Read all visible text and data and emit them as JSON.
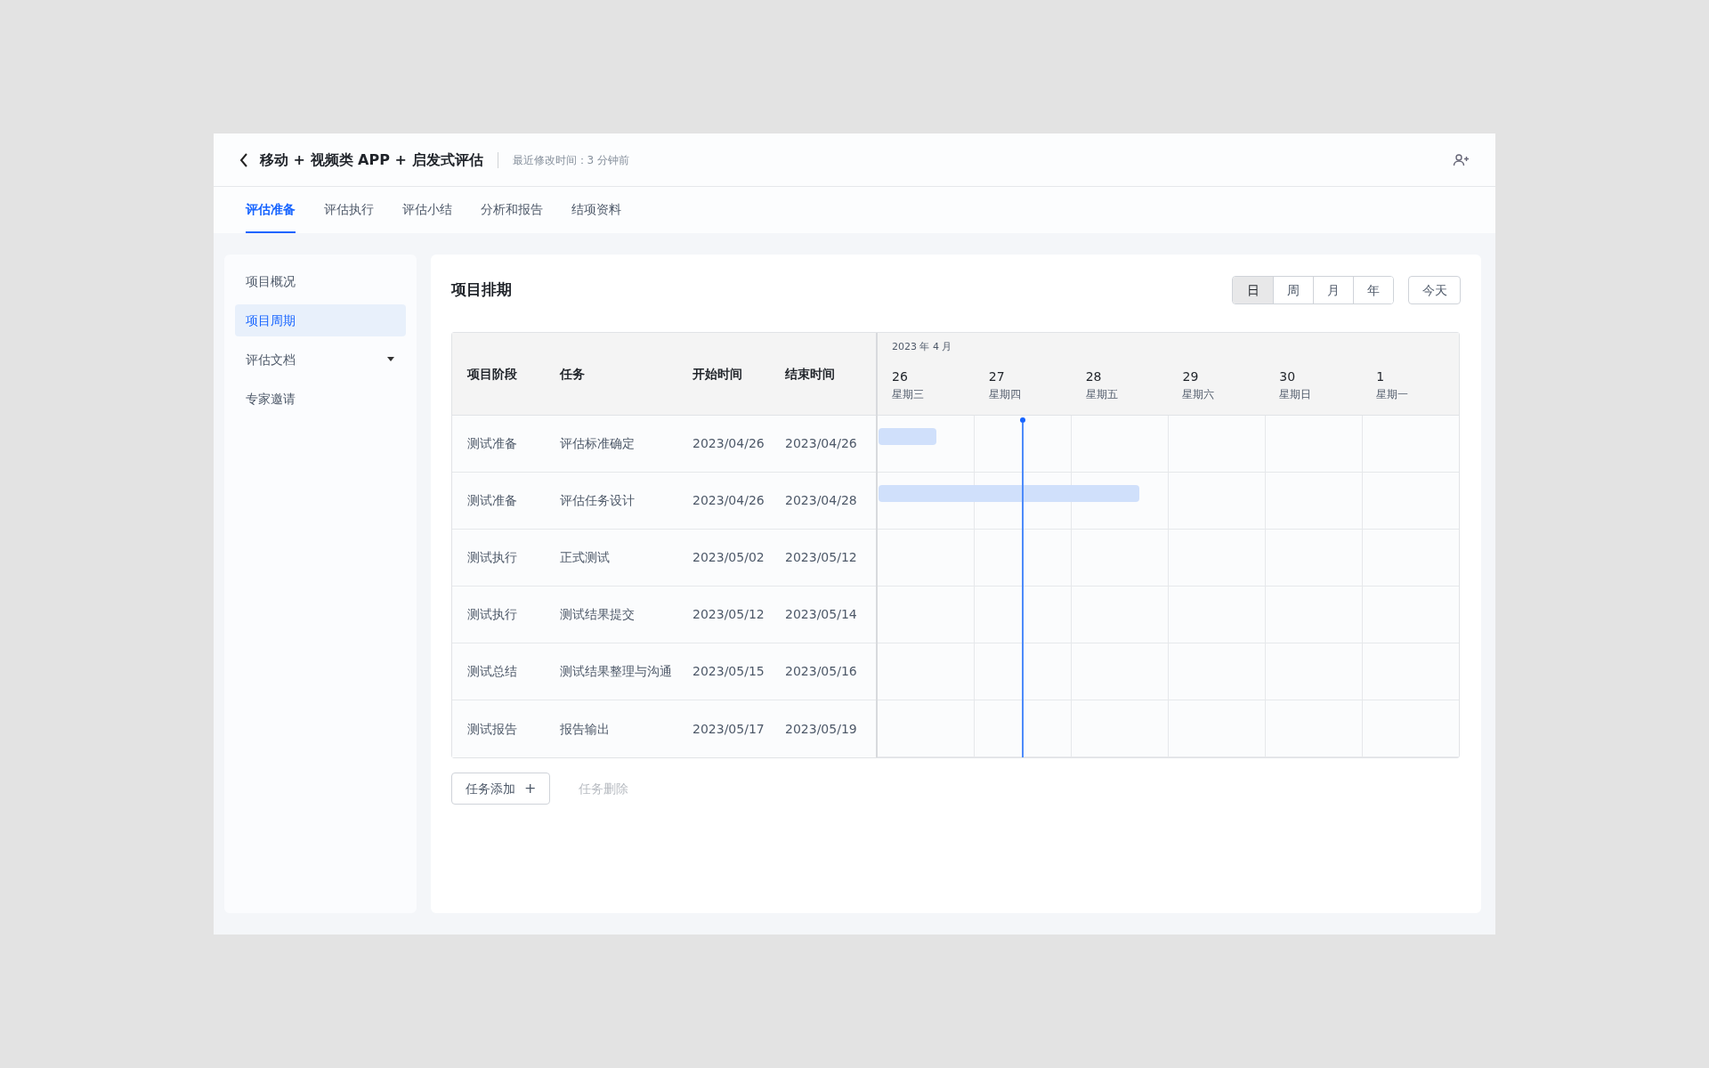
{
  "header": {
    "title": "移动 + 视频类 APP + 启发式评估",
    "subtitle": "最近修改时间：3 分钟前"
  },
  "tabs": [
    {
      "label": "评估准备",
      "selected": true
    },
    {
      "label": "评估执行",
      "selected": false
    },
    {
      "label": "评估小结",
      "selected": false
    },
    {
      "label": "分析和报告",
      "selected": false
    },
    {
      "label": "结项资料",
      "selected": false
    }
  ],
  "sidebar": {
    "items": [
      {
        "label": "项目概况",
        "selected": false,
        "kind": "link"
      },
      {
        "label": "项目周期",
        "selected": true,
        "kind": "link"
      },
      {
        "label": "评估文档",
        "selected": false,
        "kind": "dropdown"
      },
      {
        "label": "专家邀请",
        "selected": false,
        "kind": "link"
      }
    ]
  },
  "panel": {
    "title": "项目排期",
    "view_options": [
      {
        "label": "日",
        "selected": true
      },
      {
        "label": "周",
        "selected": false
      },
      {
        "label": "月",
        "selected": false
      },
      {
        "label": "年",
        "selected": false
      }
    ],
    "today_button": "今天",
    "table": {
      "columns": [
        "项目阶段",
        "任务",
        "开始时间",
        "结束时间"
      ],
      "month": "2023 年 4 月",
      "days": [
        {
          "date": "26",
          "weekday": "星期三",
          "today": false
        },
        {
          "date": "27",
          "weekday": "星期四",
          "today": true
        },
        {
          "date": "28",
          "weekday": "星期五",
          "today": false
        },
        {
          "date": "29",
          "weekday": "星期六",
          "today": false
        },
        {
          "date": "30",
          "weekday": "星期日",
          "today": false
        },
        {
          "date": "1",
          "weekday": "星期一",
          "today": false
        }
      ],
      "rows": [
        {
          "cells": [
            "测试准备",
            "评估标准确定",
            "2023/04/26",
            "2023/04/26"
          ],
          "bar": {
            "level": 0.1
          }
        },
        {
          "cells": [
            "测试准备",
            "评估任务设计",
            "2023/04/26",
            "2023/04/28"
          ],
          "bar": {
            "level": 0.45
          }
        },
        {
          "cells": [
            "测试执行",
            "正式测试",
            "2023/05/02",
            "2023/05/12"
          ]
        },
        {
          "cells": [
            "测试执行",
            "测试结果提交",
            "2023/05/12",
            "2023/05/14"
          ]
        },
        {
          "cells": [
            "测试总结",
            "测试结果整理与沟通",
            "2023/05/15",
            "2023/05/16"
          ]
        },
        {
          "cells": [
            "测试报告",
            "报告输出",
            "2023/05/17",
            "2023/05/19"
          ]
        }
      ]
    },
    "actions": [
      {
        "label": "任务添加",
        "symbol": "+",
        "disabled": false
      },
      {
        "label": "任务删除",
        "disabled": true
      }
    ]
  }
}
